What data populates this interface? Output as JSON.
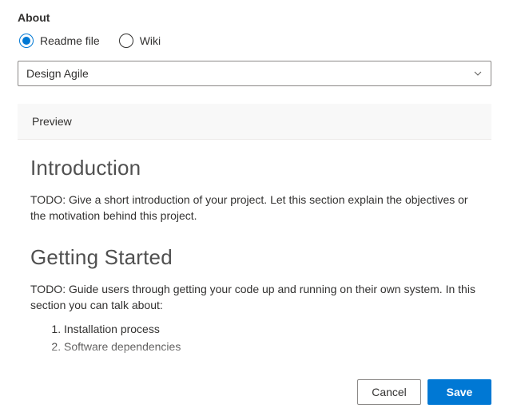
{
  "section_title": "About",
  "radio": {
    "readme_label": "Readme file",
    "wiki_label": "Wiki",
    "selected": "readme"
  },
  "dropdown": {
    "value": "Design Agile"
  },
  "preview": {
    "tab_label": "Preview"
  },
  "content": {
    "intro_heading": "Introduction",
    "intro_text": "TODO: Give a short introduction of your project. Let this section explain the objectives or the motivation behind this project.",
    "getting_started_heading": "Getting Started",
    "getting_started_text": "TODO: Guide users through getting your code up and running on their own system. In this section you can talk about:",
    "steps": [
      "Installation process",
      "Software dependencies"
    ]
  },
  "footer": {
    "cancel_label": "Cancel",
    "save_label": "Save"
  }
}
